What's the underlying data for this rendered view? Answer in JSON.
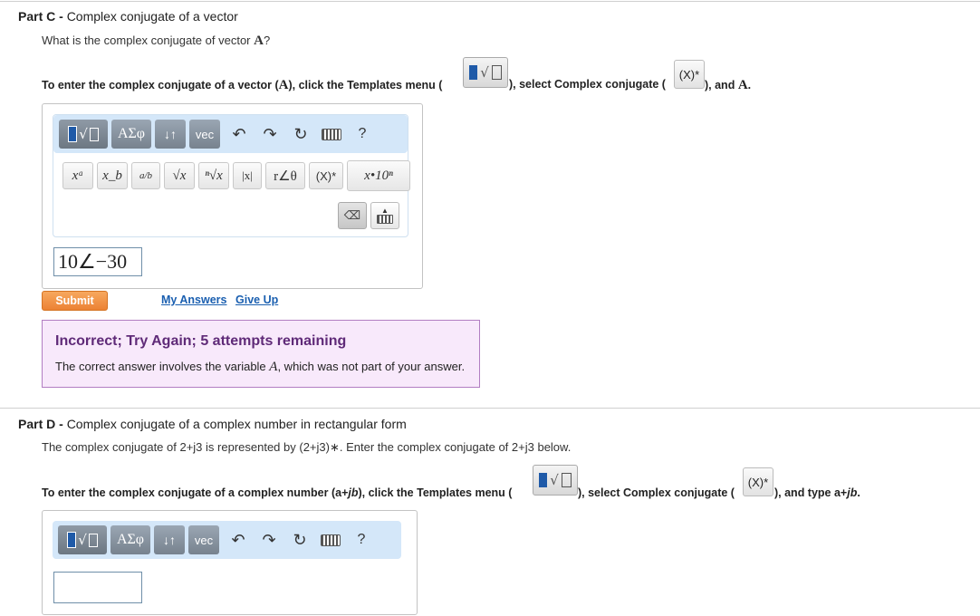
{
  "partC": {
    "label": "Part C -",
    "title": "Complex conjugate of a vector",
    "question_pre": "What is the complex conjugate of vector ",
    "question_var": "A",
    "question_post": "?",
    "instr_1": "To enter the complex conjugate of a vector (",
    "instr_var": "A",
    "instr_2": "), click the Templates menu (",
    "instr_3": "), select Complex conjugate (",
    "instr_4": "), and ",
    "instr_var2": "A",
    "instr_5": ".",
    "conj_icon_label": "(X)*",
    "toolbar": {
      "greek": "ΑΣφ",
      "arrows": "↓↑",
      "vec": "vec",
      "help": "?"
    },
    "templates": [
      "xᵃ",
      "x_b",
      "a/b",
      "√x",
      "ⁿ√x",
      "|x|",
      "r∠θ",
      "(X)*",
      "x•10ⁿ"
    ],
    "answer_value": "10∠−30",
    "submit": "Submit",
    "my_answers": "My Answers",
    "give_up": "Give Up",
    "feedback_title": "Incorrect; Try Again; 5 attempts remaining",
    "feedback_text_pre": "The correct answer involves the variable ",
    "feedback_var": "A",
    "feedback_text_post": ", which was not part of your answer."
  },
  "partD": {
    "label": "Part D -",
    "title": "Complex conjugate of a complex number in rectangular form",
    "question": "The complex conjugate of 2+j3 is represented by (2+j3)∗. Enter the complex conjugate of 2+j3 below.",
    "instr_1": "To enter the complex conjugate of a complex number (a+",
    "instr_jb": "jb",
    "instr_2": "), click the Templates menu (",
    "instr_3": "), select Complex conjugate (",
    "instr_4": "), and type a+",
    "instr_jb2": "jb",
    "instr_5": ".",
    "conj_icon_label": "(X)*",
    "toolbar": {
      "greek": "ΑΣφ",
      "arrows": "↓↑",
      "vec": "vec",
      "help": "?"
    },
    "answer_value": ""
  }
}
